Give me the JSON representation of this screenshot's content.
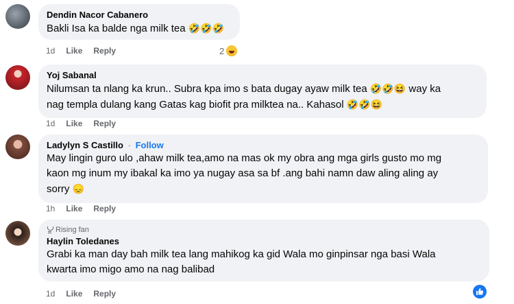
{
  "comments": [
    {
      "name": "Dendin Nacor Cabanero",
      "text": "Bakli Isa ka balde nga milk tea",
      "emoji": "🤣🤣🤣",
      "time": "1d",
      "like": "Like",
      "reply": "Reply",
      "reaction_count": "2"
    },
    {
      "name": "Yoj Sabanal",
      "text_line1": "Nilumsan ta nlang ka krun.. Subra kpa imo s bata dugay ayaw milk tea",
      "emoji1": "🤣🤣😆",
      "text_line1b": "way ka",
      "text_line2": "nag templa dulang kang Gatas kag biofit pra milktea na.. Kahasol",
      "emoji2": "🤣🤣😆",
      "time": "1d",
      "like": "Like",
      "reply": "Reply"
    },
    {
      "name": "Ladylyn S Castillo",
      "dot": "·",
      "follow": "Follow",
      "text_line1": "May lingin guro ulo ,ahaw milk tea,amo na mas ok my obra ang mga girls gusto mo mg",
      "text_line2": "kaon mg inum my ibakal ka imo ya nugay asa sa bf .ang bahi namn daw aling aling ay",
      "text_line3": "sorry",
      "emoji": "😞",
      "time": "1h",
      "like": "Like",
      "reply": "Reply"
    },
    {
      "badge": "Rising fan",
      "name": "Haylin Toledanes",
      "text_line1": "Grabi ka man day bah milk tea lang mahikog ka gid Wala mo ginpinsar nga basi Wala",
      "text_line2": "kwarta imo migo amo na nag balibad",
      "time": "1d",
      "like": "Like",
      "reply": "Reply"
    }
  ],
  "icons": {
    "reaction": "haha-face-icon",
    "fab": "like-thumb-icon"
  },
  "colors": {
    "bubble": "#f0f2f5",
    "meta": "#65676b",
    "link": "#1877f2"
  }
}
